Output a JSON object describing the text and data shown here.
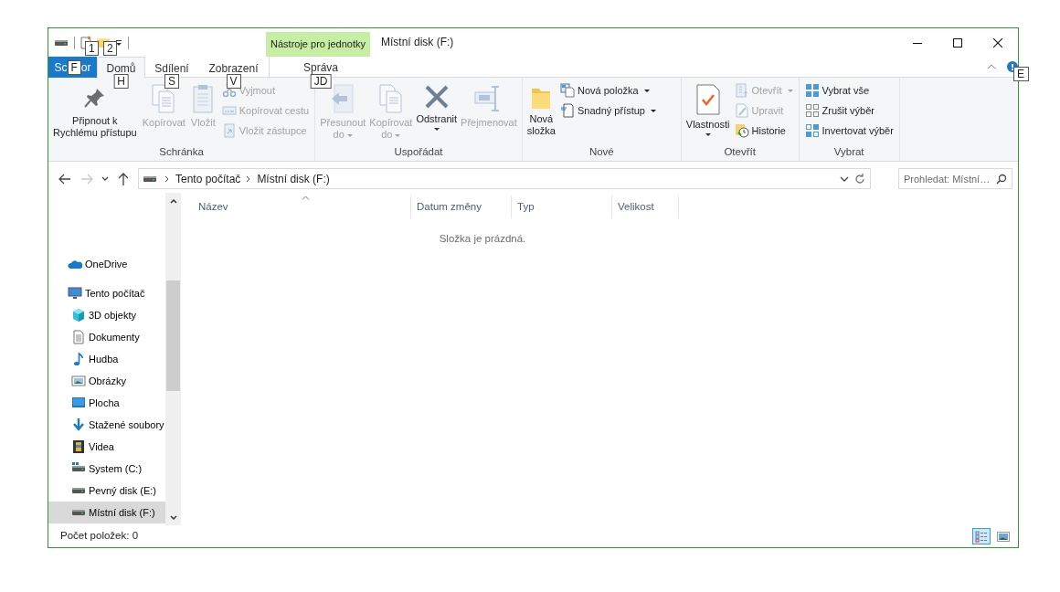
{
  "window": {
    "title": "Místní disk (F:)",
    "context_tab": "Nástroje pro jednotky"
  },
  "quick_access": {
    "keytips": [
      "1",
      "2"
    ]
  },
  "file_tab": {
    "text_before": "Sc",
    "keytip": "F",
    "text_after": "or"
  },
  "ribbon_tabs": [
    {
      "label": "Domů",
      "keytip": "H",
      "selected": true,
      "contextual": false
    },
    {
      "label": "Sdílení",
      "keytip": "S",
      "selected": false,
      "contextual": false
    },
    {
      "label": "Zobrazení",
      "keytip": "V",
      "selected": false,
      "contextual": false
    },
    {
      "label": "Správa",
      "keytip": "JD",
      "selected": false,
      "contextual": true
    }
  ],
  "help_keytip": "E",
  "ribbon_groups": [
    {
      "label": "Schránka",
      "items": [
        {
          "kind": "large",
          "label": "Připnout k\nRychlému přístupu",
          "disabled": false
        },
        {
          "kind": "large",
          "label": "Kopírovat",
          "disabled": true
        },
        {
          "kind": "large",
          "label": "Vložit",
          "disabled": true
        },
        {
          "kind": "stack",
          "items": [
            {
              "label": "Vyjmout",
              "disabled": true,
              "dropdown": false
            },
            {
              "label": "Kopírovat cestu",
              "disabled": true,
              "dropdown": false
            },
            {
              "label": "Vložit zástupce",
              "disabled": true,
              "dropdown": false
            }
          ]
        }
      ]
    },
    {
      "label": "Uspořádat",
      "items": [
        {
          "kind": "large",
          "label": "Přesunout\ndo",
          "disabled": true,
          "dropdown": true
        },
        {
          "kind": "large",
          "label": "Kopírovat\ndo",
          "disabled": true,
          "dropdown": true
        },
        {
          "kind": "large",
          "label": "Odstranit",
          "disabled": false,
          "dropdown": true
        },
        {
          "kind": "large",
          "label": "Přejmenovat",
          "disabled": true
        }
      ]
    },
    {
      "label": "Nové",
      "items": [
        {
          "kind": "large",
          "label": "Nová\nsložka",
          "disabled": false
        },
        {
          "kind": "stack",
          "items": [
            {
              "label": "Nová položka",
              "disabled": false,
              "dropdown": true
            },
            {
              "label": "Snadný přístup",
              "disabled": false,
              "dropdown": true
            }
          ]
        }
      ]
    },
    {
      "label": "Otevřít",
      "items": [
        {
          "kind": "large",
          "label": "Vlastnosti",
          "disabled": false,
          "dropdown": true
        },
        {
          "kind": "stack",
          "items": [
            {
              "label": "Otevřít",
              "disabled": true,
              "dropdown": true
            },
            {
              "label": "Upravit",
              "disabled": true,
              "dropdown": false
            },
            {
              "label": "Historie",
              "disabled": false,
              "dropdown": false
            }
          ]
        }
      ]
    },
    {
      "label": "Vybrat",
      "items": [
        {
          "kind": "stack",
          "items": [
            {
              "label": "Vybrat vše",
              "disabled": false,
              "dropdown": false
            },
            {
              "label": "Zrušit výběr",
              "disabled": false,
              "dropdown": false
            },
            {
              "label": "Invertovat výběr",
              "disabled": false,
              "dropdown": false
            }
          ]
        }
      ]
    }
  ],
  "nav_buttons": [
    {
      "kind": "back",
      "disabled": false
    },
    {
      "kind": "forward",
      "disabled": true
    },
    {
      "kind": "recent",
      "disabled": false
    },
    {
      "kind": "up",
      "disabled": false
    }
  ],
  "address": {
    "crumbs": [
      "Tento počítač",
      "Místní disk (F:)"
    ],
    "search_placeholder": "Prohledat: Místní…"
  },
  "nav_tree": [
    {
      "label": "OneDrive",
      "selected": false
    },
    {
      "label": "Tento počítač",
      "selected": false,
      "children": [
        {
          "label": "3D objekty",
          "selected": false
        },
        {
          "label": "Dokumenty",
          "selected": false
        },
        {
          "label": "Hudba",
          "selected": false
        },
        {
          "label": "Obrázky",
          "selected": false
        },
        {
          "label": "Plocha",
          "selected": false
        },
        {
          "label": "Stažené soubory",
          "selected": false
        },
        {
          "label": "Videa",
          "selected": false
        },
        {
          "label": "System (C:)",
          "selected": false
        },
        {
          "label": "Pevný disk (E:)",
          "selected": false
        },
        {
          "label": "Místní disk (F:)",
          "selected": true
        }
      ]
    }
  ],
  "columns": [
    {
      "label": "Název",
      "sorted": true
    },
    {
      "label": "Datum změny",
      "sorted": false
    },
    {
      "label": "Typ",
      "sorted": false
    },
    {
      "label": "Velikost",
      "sorted": false
    }
  ],
  "empty_message": "Složka je prázdná.",
  "status_bar": {
    "item_count": "Počet položek: 0",
    "views": [
      {
        "kind": "details",
        "selected": true
      },
      {
        "kind": "thumbnails",
        "selected": false
      }
    ]
  }
}
